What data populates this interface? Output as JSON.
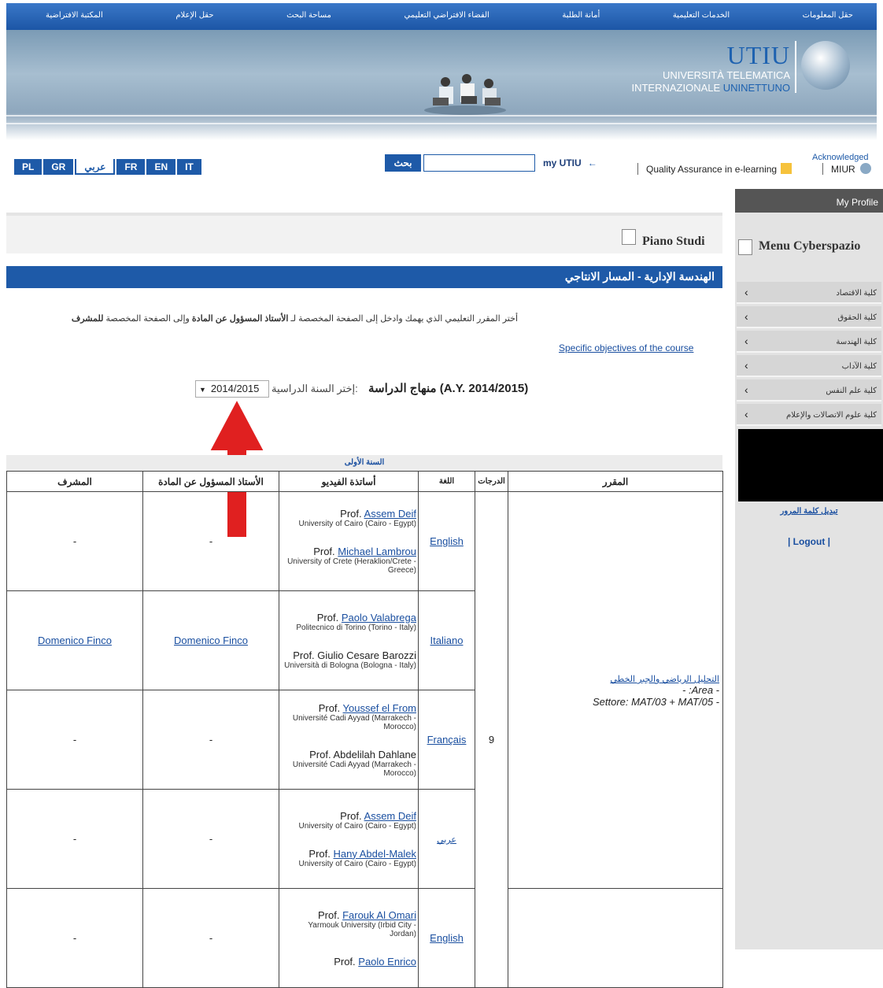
{
  "topnav": [
    "حقل المعلومات",
    "الخدمات التعليمية",
    "أمانة الطلبة",
    "الفضاء الافتراضي التعليمي",
    "مساحة البحث",
    "حقل الإعلام",
    "المكتبة الافتراضية"
  ],
  "banner": {
    "logo": "UTIU",
    "line1": "UNIVERSITÀ TELEMATICA",
    "line2a": "INTERNAZIONALE",
    "line2b": "UNINETTUNO"
  },
  "languages": [
    "PL",
    "GR",
    "عربي",
    "FR",
    "EN",
    "IT"
  ],
  "search": {
    "button": "بحث",
    "value": ""
  },
  "my_utiu": "my UTIU",
  "my_utiu_arrow": "←",
  "acknowledged": "Acknowledged",
  "quality": "Quality Assurance in e-learning",
  "miur": "MIUR",
  "sidebar": {
    "my_profile": "My Profile",
    "menu_title": "Menu Cyberspazio",
    "items": [
      "كلية الاقتصاد",
      "كلية الحقوق",
      "كلية الهندسة",
      "كلية الآداب",
      "كلية علم النفس",
      "كلية علوم الاتصالات والإعلام"
    ],
    "change_password": "تبديل كلمة المرور",
    "logout": "| Logout |"
  },
  "page": {
    "piano": "Piano Studi",
    "bar_title": "الهندسة الإدارية - المسار الانتاجي",
    "instruction_pre": "أختر المقرر التعليمي الذي يهمك وادخل إلى الصفحة المخصصة لـ ",
    "instruction_b1": "الأستاذ المسؤول عن المادة",
    "instruction_mid": " وإلى الصفحة المخصصة ",
    "instruction_b2": "للمشرف",
    "specific": "Specific objectives of the course",
    "curriculum": "منهاج الدراسة (A.Y. 2014/2015)",
    "year_label": "إختر السنة الدراسية:",
    "year_value": "2014/2015",
    "year_header": "السنة الأولى"
  },
  "table": {
    "headers": {
      "supervisor": "المشرف",
      "responsible": "الأستاذ المسؤول عن المادة",
      "video": "أساتذة الفيديو",
      "lang": "اللغة",
      "credits": "الدرجات",
      "course": "المقرر"
    },
    "course": {
      "name": "التحليل الرياضي والجبر الخطي",
      "area": "- :Area -",
      "settore": "Settore: MAT/03 + MAT/05 -",
      "credits": "9"
    },
    "rows": [
      {
        "supervisor": "-",
        "responsible": "-",
        "lang": "English",
        "profs": [
          {
            "prefix": "Prof. ",
            "name": "Assem Deif",
            "uni": "University of Cairo (Cairo - Egypt)"
          },
          {
            "prefix": "Prof. ",
            "name": "Michael Lambrou",
            "uni": "University of Crete (Heraklion/Crete - Greece)"
          }
        ]
      },
      {
        "supervisor": "Domenico Finco",
        "responsible": "Domenico Finco",
        "lang": "Italiano",
        "profs": [
          {
            "prefix": "Prof. ",
            "name": "Paolo Valabrega",
            "uni": "Politecnico di Torino (Torino - Italy)"
          },
          {
            "prefix": "Prof. Giulio Cesare Barozzi",
            "name": "",
            "uni": "Università di Bologna (Bologna - Italy)"
          }
        ]
      },
      {
        "supervisor": "-",
        "responsible": "-",
        "lang": "Français",
        "profs": [
          {
            "prefix": "Prof. ",
            "name": "Youssef el From",
            "uni": "Université Cadi Ayyad (Marrakech - Morocco)"
          },
          {
            "prefix": "Prof. Abdelilah Dahlane",
            "name": "",
            "uni": "Université Cadi Ayyad (Marrakech - Morocco)"
          }
        ]
      },
      {
        "supervisor": "-",
        "responsible": "-",
        "lang": "عربي",
        "profs": [
          {
            "prefix": "Prof. ",
            "name": "Assem Deif",
            "uni": "University of Cairo (Cairo - Egypt)"
          },
          {
            "prefix": "Prof. ",
            "name": "Hany Abdel-Malek",
            "uni": "University of Cairo (Cairo - Egypt)"
          }
        ]
      },
      {
        "supervisor": "-",
        "responsible": "-",
        "lang": "English",
        "profs": [
          {
            "prefix": "Prof. ",
            "name": "Farouk Al Omari",
            "uni": "Yarmouk University (Irbid City - Jordan)"
          },
          {
            "prefix": "Prof. ",
            "name": "Paolo Enrico",
            "uni": ""
          }
        ]
      }
    ]
  }
}
